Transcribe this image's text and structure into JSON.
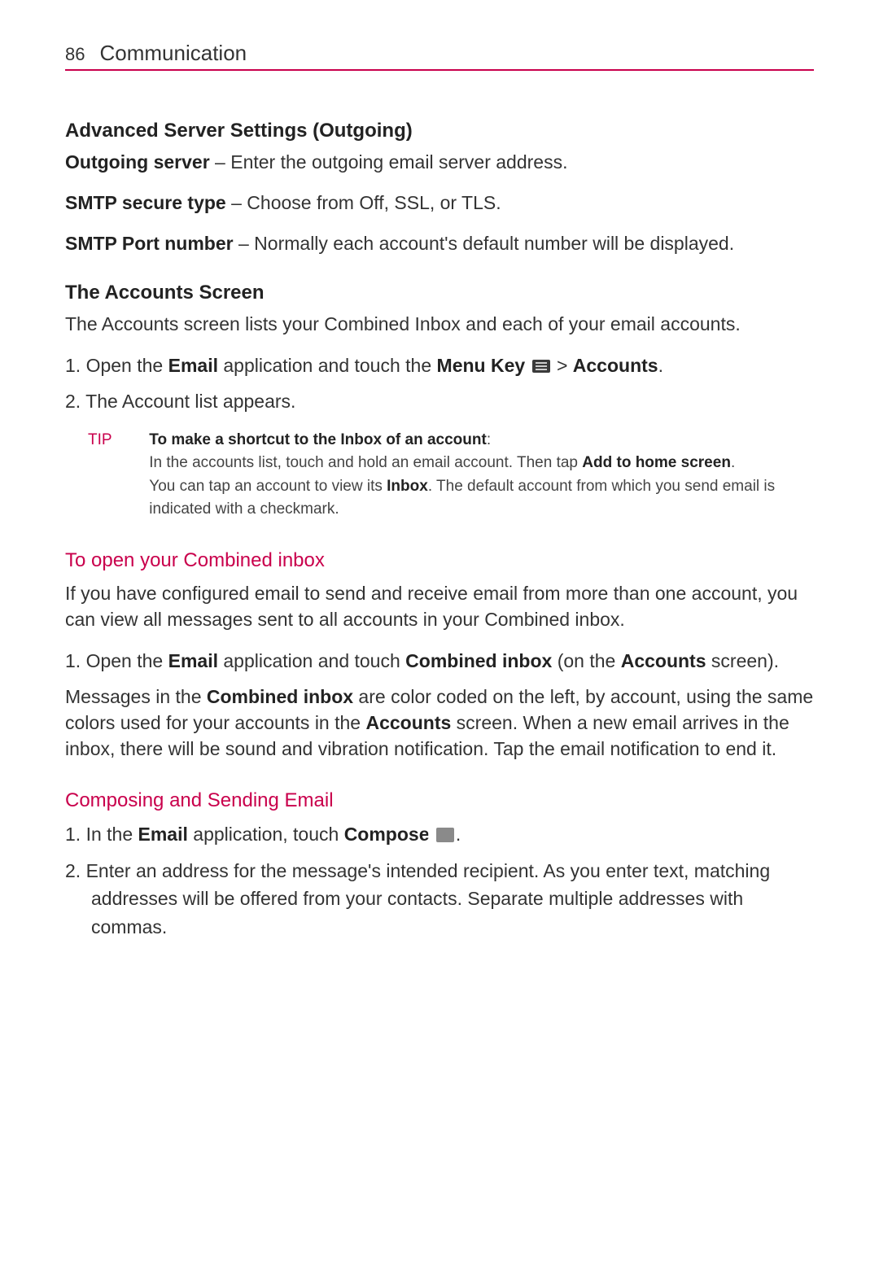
{
  "header": {
    "page_number": "86",
    "section_title": "Communication"
  },
  "advanced_settings": {
    "heading": "Advanced Server Settings (Outgoing)",
    "outgoing_label": "Outgoing  server",
    "outgoing_desc": " – Enter the outgoing email server address.",
    "smtp_type_label": "SMTP secure type",
    "smtp_type_desc": " – Choose from Off, SSL, or TLS.",
    "smtp_port_label": "SMTP Port number",
    "smtp_port_desc": " – Normally each account's default number will be displayed."
  },
  "accounts_screen": {
    "heading": "The Accounts Screen",
    "intro": "The Accounts screen lists your Combined Inbox and each of your email accounts.",
    "step1_num": "1.",
    "step1_a": " Open the ",
    "step1_email": "Email",
    "step1_b": " application and touch the ",
    "step1_menu": "Menu Key ",
    "step1_c": " > ",
    "step1_accounts": "Accounts",
    "step1_d": ".",
    "step2_num": "2.",
    "step2_text": " The Account list appears."
  },
  "tip": {
    "label": "TIP",
    "title": "To make a shortcut to the Inbox of an account",
    "colon": ":",
    "line2a": "In the accounts list, touch and hold an email account. Then tap ",
    "line2b": "Add to home screen",
    "line2c": ".",
    "line3a": "You can tap an account to view its ",
    "line3b": "Inbox",
    "line3c": ". The default account from which you send email is indicated with a checkmark."
  },
  "combined_inbox": {
    "heading": "To open your Combined inbox",
    "intro": "If you have configured email to send and receive email from more than one account, you can view all messages sent to all accounts in your Combined inbox.",
    "step1_num": "1.",
    "step1_a": " Open the ",
    "step1_email": "Email",
    "step1_b": " application and touch ",
    "step1_ci": "Combined inbox",
    "step1_c": " (on the ",
    "step1_acc": "Accounts",
    "step1_d": " screen).",
    "para2a": "Messages in the ",
    "para2b": "Combined inbox",
    "para2c": " are color coded on the left, by account, using the same colors used for your accounts in the ",
    "para2d": "Accounts",
    "para2e": " screen. When a new email arrives in the inbox, there will be sound and vibration notification. Tap the email notification to end it."
  },
  "composing": {
    "heading": "Composing and Sending Email",
    "step1_num": "1.",
    "step1_a": " In the ",
    "step1_email": "Email",
    "step1_b": " application, touch ",
    "step1_compose": "Compose ",
    "step1_c": ".",
    "step2_num": "2.",
    "step2_text": " Enter an address for the message's intended recipient. As you enter text, matching addresses will be offered from your contacts. Separate multiple addresses with commas."
  }
}
